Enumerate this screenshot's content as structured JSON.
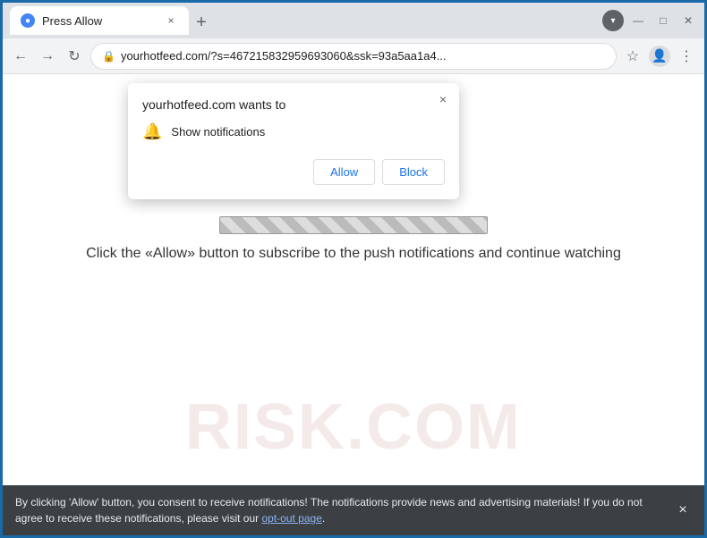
{
  "browser": {
    "tab_title": "Press Allow",
    "tab_close": "×",
    "new_tab": "+",
    "window_controls": {
      "minimize": "—",
      "maximize": "□",
      "close": "✕"
    },
    "nav": {
      "back": "←",
      "forward": "→",
      "refresh": "↻"
    },
    "url": "yourhotfeed.com/?s=467215832959693060&ssk=93a5aa1a4...",
    "lock_symbol": "🔒"
  },
  "notification_popup": {
    "title": "yourhotfeed.com wants to",
    "close": "×",
    "notification_label": "Show notifications",
    "allow_button": "Allow",
    "block_button": "Block"
  },
  "page": {
    "cta_text": "Click the «Allow» button to subscribe to the push notifications and continue watching",
    "risk_watermark": "RISK.COM"
  },
  "bottom_bar": {
    "text": "By clicking 'Allow' button, you consent to receive notifications! The notifications provide news and advertising materials! If you do not agree to receive these notifications, please visit our ",
    "link_text": "opt-out page",
    "close": "×"
  }
}
